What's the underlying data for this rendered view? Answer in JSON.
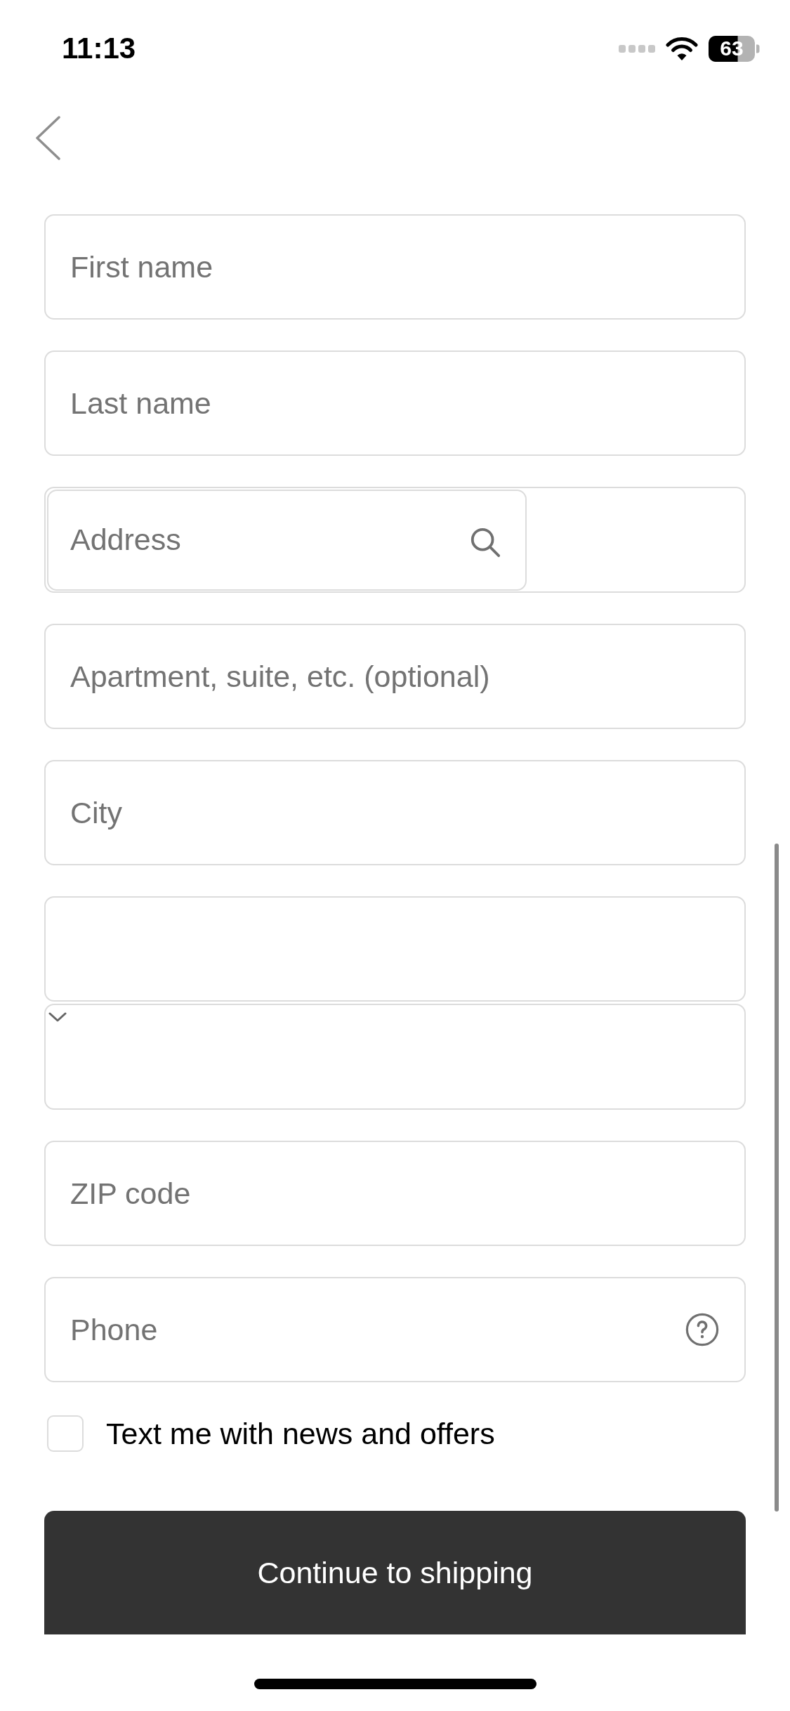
{
  "status_bar": {
    "time": "11:13",
    "battery": "63"
  },
  "form": {
    "fields": [
      {
        "kind": "text",
        "placeholder": "First name"
      },
      {
        "kind": "text",
        "placeholder": "Last name"
      },
      {
        "kind": "search",
        "placeholder": "Address"
      },
      {
        "kind": "text",
        "placeholder": "Apartment, suite, etc. (optional)"
      },
      {
        "kind": "text",
        "placeholder": "City"
      },
      {
        "kind": "empty"
      },
      {
        "kind": "select"
      },
      {
        "kind": "text",
        "placeholder": "ZIP code"
      },
      {
        "kind": "help",
        "placeholder": "Phone"
      }
    ],
    "consent": {
      "label": "Text me with news and offers",
      "checked": false
    },
    "submit": {
      "label": "Continue to shipping"
    }
  }
}
